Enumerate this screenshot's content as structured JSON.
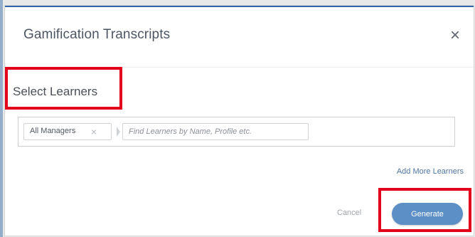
{
  "modal": {
    "title": "Gamification Transcripts",
    "close_icon": "×"
  },
  "learners": {
    "section_label": "Select Learners",
    "chip_label": "All Managers",
    "chip_remove_icon": "×",
    "search_placeholder": "Find Learners by Name, Profile etc.",
    "add_more_label": "Add More Learners"
  },
  "footer": {
    "cancel_label": "Cancel",
    "generate_label": "Generate"
  },
  "colors": {
    "accent": "#2f66a7",
    "highlight": "#e3001b",
    "primary_button": "#5d8fc7"
  },
  "icons": {
    "close": "close-icon",
    "chip_remove": "remove-chip-icon"
  }
}
